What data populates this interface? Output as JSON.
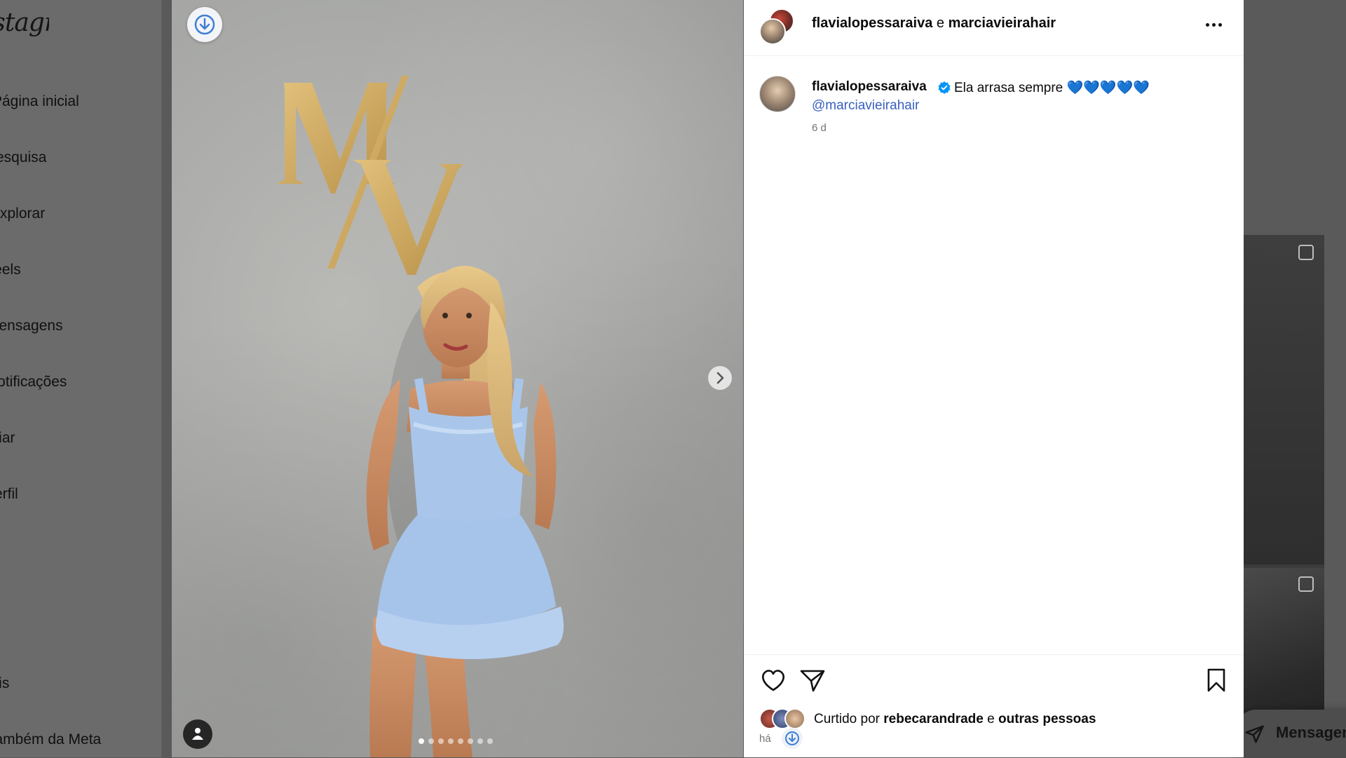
{
  "sidebar": {
    "logo_text": "Instagram",
    "items": [
      {
        "label": "Página inicial"
      },
      {
        "label": "Pesquisa"
      },
      {
        "label": "Explorar"
      },
      {
        "label": "Reels"
      },
      {
        "label": "Mensagens"
      },
      {
        "label": "Notificações"
      },
      {
        "label": "Criar"
      },
      {
        "label": "Perfil"
      },
      {
        "label": "Mais"
      },
      {
        "label": "Também da Meta"
      }
    ]
  },
  "floating_messages": {
    "label": "Mensagens",
    "icon": "send-icon"
  },
  "post": {
    "media": {
      "wall_logo": "M/V",
      "carousel_count": 8,
      "carousel_active_index": 0,
      "icons": [
        "download-icon",
        "chevron-right-icon",
        "user-tag-icon"
      ]
    },
    "header": {
      "author": "flavialopessaraiva",
      "joiner": "e",
      "collaborator": "marciavieirahair",
      "more_icon": "more-horizontal-icon"
    },
    "caption": {
      "username": "flavialopessaraiva",
      "verified": true,
      "text": "Ela arrasa sempre 💙💙💙💙💙",
      "mention": "@marciavieirahair",
      "time": "6 d"
    },
    "actions": {
      "icons": [
        "heart-icon",
        "share-icon",
        "bookmark-icon"
      ],
      "liked_prefix": "Curtido por",
      "liked_user": "rebecarandrade",
      "liked_joiner": "e",
      "liked_others": "outras pessoas",
      "time_ago": "há"
    }
  },
  "colors": {
    "backdrop": "#5a5a5a",
    "link": "#385fbf",
    "verified": "#0095f6",
    "dress": "#a9c6ea",
    "logo_gold": "#c9a661"
  }
}
